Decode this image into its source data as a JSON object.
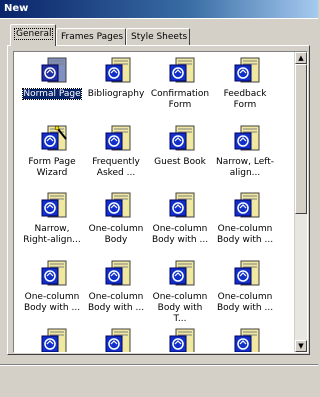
{
  "window": {
    "title": "New"
  },
  "tabs": [
    {
      "label": "General",
      "active": true
    },
    {
      "label": "Frames Pages",
      "active": false
    },
    {
      "label": "Style Sheets",
      "active": false
    }
  ],
  "templates": [
    {
      "label": "Normal Page",
      "selected": true
    },
    {
      "label": "Bibliography"
    },
    {
      "label": "Confirmation Form"
    },
    {
      "label": "Feedback Form"
    },
    {
      "label": "Form Page Wizard",
      "wizard": true
    },
    {
      "label": "Frequently Asked ..."
    },
    {
      "label": "Guest Book"
    },
    {
      "label": "Narrow, Left-align..."
    },
    {
      "label": "Narrow, Right-align..."
    },
    {
      "label": "One-column Body"
    },
    {
      "label": "One-column Body with ..."
    },
    {
      "label": "One-column Body with ..."
    },
    {
      "label": "One-column Body with ..."
    },
    {
      "label": "One-column Body with ..."
    },
    {
      "label": "One-column Body with T..."
    },
    {
      "label": "One-column Body with ..."
    },
    {
      "label": ""
    },
    {
      "label": ""
    },
    {
      "label": ""
    },
    {
      "label": ""
    }
  ],
  "colors": {
    "selection": "#0a246a",
    "icon_blue": "#1030c8",
    "page_yellow": "#f0e8a0"
  }
}
